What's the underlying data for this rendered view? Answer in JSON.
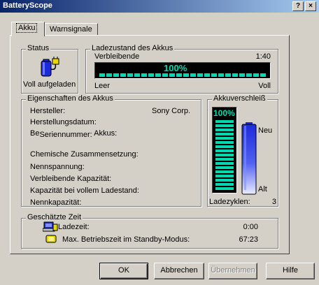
{
  "window": {
    "title": "BatteryScope",
    "help_btn": "?",
    "close_btn": "×"
  },
  "tabs": [
    {
      "label": "Akku"
    },
    {
      "label": "Warnsignale"
    }
  ],
  "status": {
    "legend": "Status",
    "text": "Voll aufgeladen"
  },
  "charge": {
    "legend": "Ladezustand des Akkus",
    "remaining_label": "Verbleibende",
    "remaining_time": "1:40",
    "percent_text": "100%",
    "percent": 100,
    "left_label": "Leer",
    "right_label": "Voll"
  },
  "props": {
    "legend": "Eigenschaften des Akkus",
    "manufacturer_label": "Hersteller:",
    "manufacturer_value": "Sony Corp.",
    "prod_date_label": "Herstellungsdatum:",
    "serial_prefix": "Be",
    "serial_label": "Seriennummer:",
    "serial_suffix": "Akkus:",
    "chemistry_label": "Chemische Zusammensetzung:",
    "voltage_label": "Nennspannung:",
    "remaining_capacity_label": "Verbleibende Kapazität:",
    "full_capacity_label": "Kapazität bei vollem Ladestand:",
    "nominal_capacity_label": "Nennkapazität:"
  },
  "wear": {
    "legend": "Akkuverschleiß",
    "percent_text": "100%",
    "percent": 100,
    "new_label": "Neu",
    "old_label": "Alt",
    "cycles_label": "Ladezyklen:",
    "cycles_value": "3"
  },
  "time": {
    "legend": "Geschätzte Zeit",
    "charge_label": "Ladezeit:",
    "charge_value": "0:00",
    "standby_label": "Max. Betriebszeit im Standby-Modus:",
    "standby_value": "67:23"
  },
  "buttons": {
    "ok": "OK",
    "cancel": "Abbrechen",
    "apply": "Übernehmen",
    "help": "Hilfe"
  },
  "colors": {
    "lcd_green": "#00d8b0",
    "lcd_bg": "#000000",
    "gauge_blue": "#1c2bd8"
  }
}
